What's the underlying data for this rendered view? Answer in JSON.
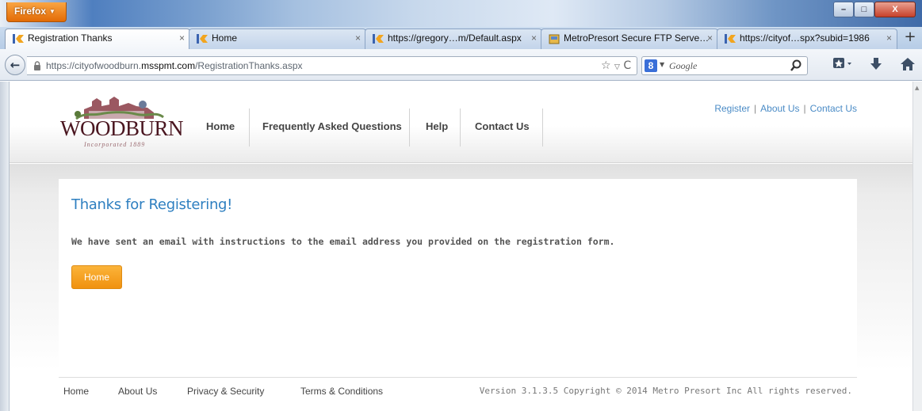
{
  "browser": {
    "menu_label": "Firefox",
    "tabs": [
      {
        "title": "Registration Thanks",
        "active": true
      },
      {
        "title": "Home",
        "active": false
      },
      {
        "title": "https://gregory…m/Default.aspx",
        "active": false
      },
      {
        "title": "MetroPresort Secure FTP Serve…",
        "active": false
      },
      {
        "title": "https://cityof…spx?subid=1986",
        "active": false
      }
    ],
    "new_tab_label": "+",
    "url_prefix": "https://cityofwoodburn.",
    "url_domain": "msspmt.com",
    "url_path": "/RegistrationThanks.aspx",
    "search_placeholder": "Google",
    "icons": [
      "back-icon",
      "lock-icon",
      "star-icon",
      "dropmarker-icon",
      "reload-icon",
      "google-icon",
      "search-icon",
      "bookmarks-icon",
      "download-icon",
      "home-icon"
    ]
  },
  "site": {
    "logo_text": "WOODBURN",
    "logo_subtext": "Incorporated 1889",
    "nav": [
      "Home",
      "Frequently Asked Questions",
      "Help",
      "Contact Us"
    ],
    "top_links": [
      "Register",
      "About Us",
      "Contact Us"
    ],
    "top_links_sep": "|"
  },
  "content": {
    "title": "Thanks for Registering!",
    "message": "We have sent an email with instructions to the email address you provided on the registration form.",
    "home_button": "Home"
  },
  "footer": {
    "links": [
      "Home",
      "About Us",
      "Privacy & Security",
      "Terms & Conditions"
    ],
    "version": "Version 3.1.3.5 Copyright © 2014 Metro Presort Inc All rights reserved."
  },
  "colors": {
    "accent_blue": "#2e7fc0",
    "link_blue": "#4a8bc6",
    "button_orange": "#f5a024",
    "firefox_orange": "#e36b05",
    "logo_maroon": "#6b1f2a"
  }
}
